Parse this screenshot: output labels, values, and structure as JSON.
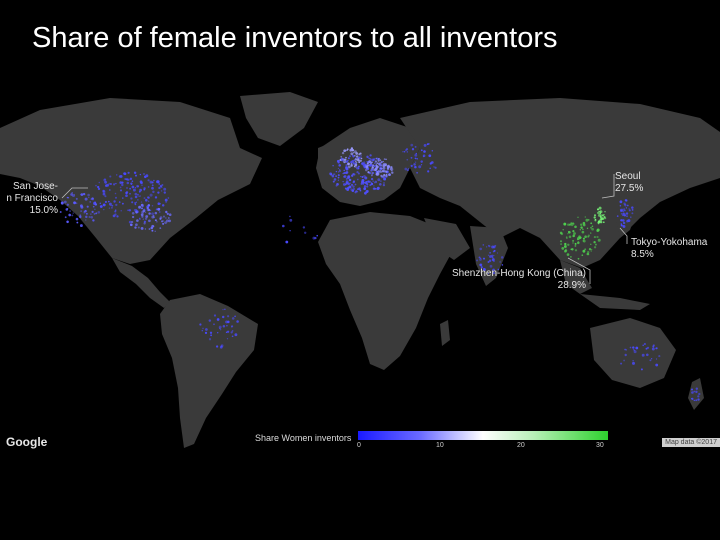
{
  "title": "Share of female inventors to all inventors",
  "callouts": {
    "san_jose": {
      "line1": "San Jose-",
      "line2": "n Francisco",
      "value": "15.0%"
    },
    "seoul": {
      "line1": "Seoul",
      "value": "27.5%"
    },
    "tokyo": {
      "line1": "Tokyo-Yokohama",
      "value": "8.5%"
    },
    "shenzhen": {
      "line1": "Shenzhen-Hong Kong (China)",
      "value": "28.9%"
    }
  },
  "legend": {
    "title": "Share Women inventors",
    "ticks": [
      "0",
      "10",
      "20",
      "30"
    ],
    "colors": {
      "low": "#1a1aff",
      "mid": "#ffffff",
      "high": "#2ed12e"
    }
  },
  "branding": {
    "logo": "Google",
    "credit": "Map data ©2017"
  },
  "colors": {
    "land": "#3a3a3a",
    "ocean": "#000000"
  }
}
